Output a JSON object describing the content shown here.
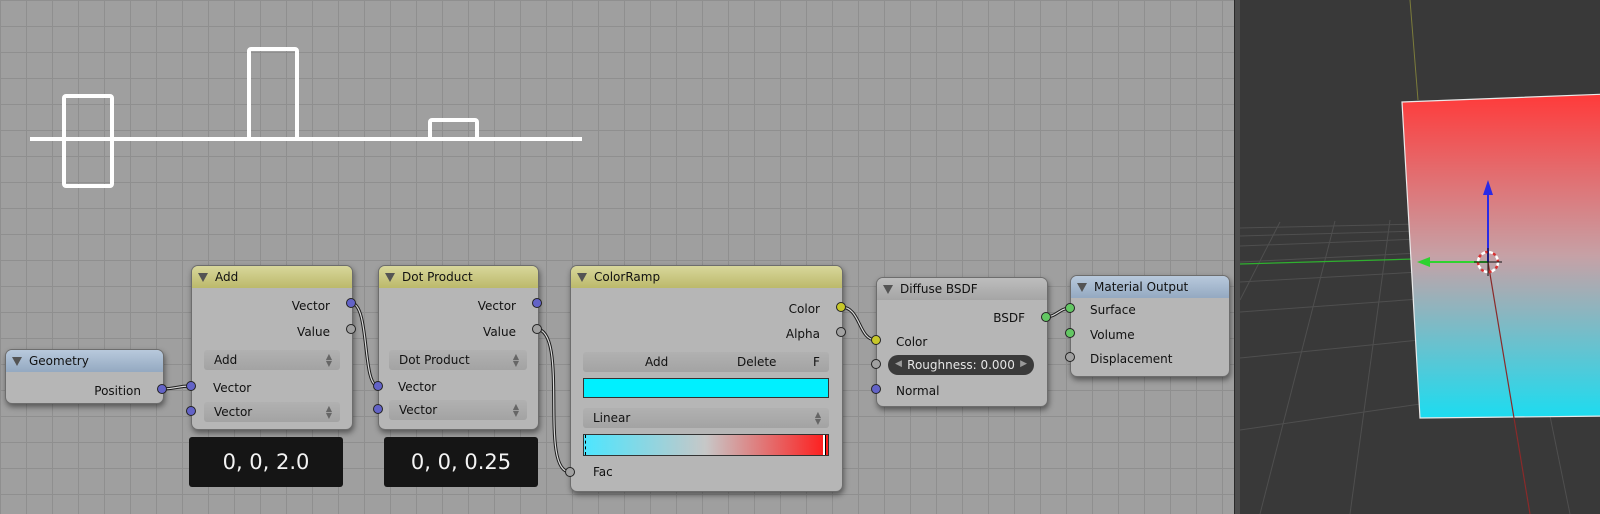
{
  "nodes": {
    "geometry": {
      "title": "Geometry",
      "output_position": "Position"
    },
    "add": {
      "title": "Add",
      "output_vector": "Vector",
      "output_value": "Value",
      "operation": "Add",
      "input1": "Vector",
      "input2": "Vector"
    },
    "dot": {
      "title": "Dot Product",
      "output_vector": "Vector",
      "output_value": "Value",
      "operation": "Dot Product",
      "input1": "Vector",
      "input2": "Vector"
    },
    "colorramp": {
      "title": "ColorRamp",
      "output_color": "Color",
      "output_alpha": "Alpha",
      "add_label": "Add",
      "delete_label": "Delete",
      "flip_label": "F",
      "interpolation": "Linear",
      "input_fac": "Fac",
      "active_color": "#00f0ff",
      "start_color": "#4ce6ff",
      "end_color": "#ff1a1a"
    },
    "diffuse": {
      "title": "Diffuse BSDF",
      "output_bsdf": "BSDF",
      "input_color": "Color",
      "roughness": "Roughness: 0.000",
      "input_normal": "Normal"
    },
    "output": {
      "title": "Material Output",
      "input_surface": "Surface",
      "input_volume": "Volume",
      "input_displacement": "Displacement"
    }
  },
  "value_boxes": {
    "add_value": "0, 0, 2.0",
    "dot_value": "0, 0, 0.25"
  },
  "colors": {
    "vector_socket": "#6363c7",
    "value_socket": "#a1a1a1",
    "color_socket": "#c7c729",
    "shader_socket": "#63c763",
    "plane_top": "#ff3a3a",
    "plane_bottom": "#1cdcf0"
  }
}
